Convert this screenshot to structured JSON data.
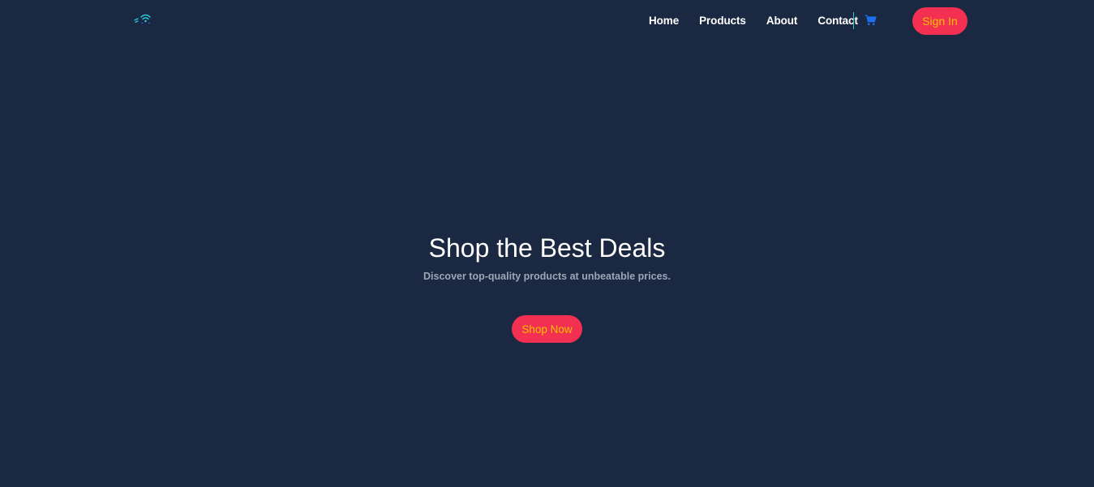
{
  "nav": {
    "logo": "wifi-logo-icon",
    "links": [
      {
        "label": "Home"
      },
      {
        "label": "Products"
      },
      {
        "label": "About"
      },
      {
        "label": "Contact"
      }
    ],
    "cart_icon": "shopping-cart-icon",
    "signin_label": "Sign In"
  },
  "hero": {
    "title": "Shop the Best Deals",
    "subtitle": "Discover top-quality products at unbeatable prices.",
    "cta_label": "Shop Now"
  },
  "colors": {
    "background": "#1b2841",
    "accent_button": "#f43052",
    "button_text": "#f2c200",
    "divider": "#29c7d4",
    "cart_icon": "#1e6ff0",
    "subtitle_text": "#9da6b5"
  }
}
